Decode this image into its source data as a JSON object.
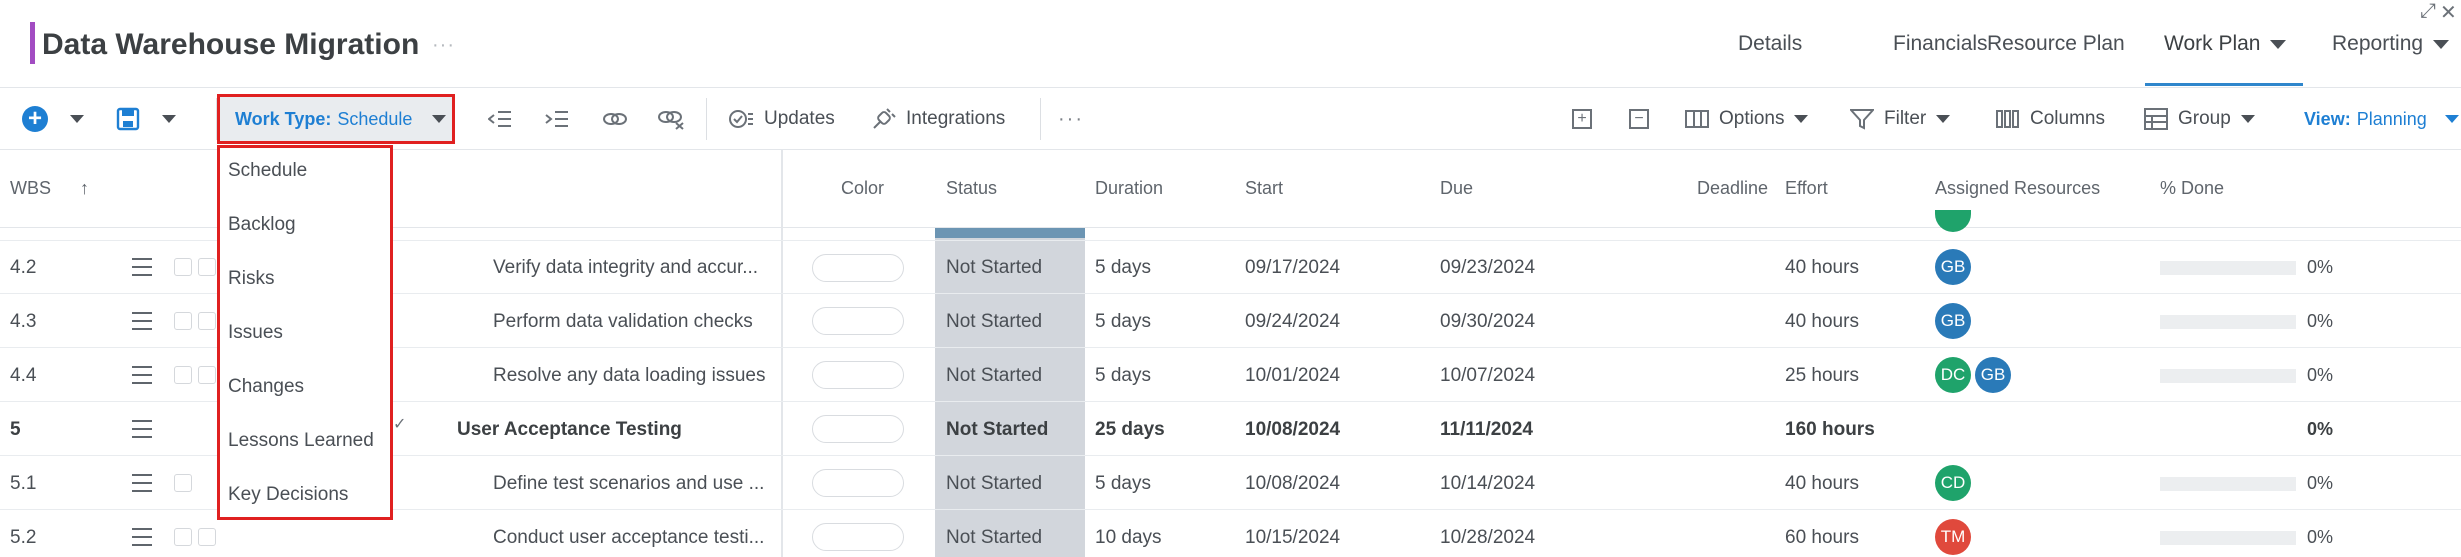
{
  "header": {
    "title": "Data Warehouse Migration",
    "more": "···",
    "window_controls": {
      "expand": "⤢",
      "close": "✕"
    },
    "nav": [
      {
        "label": "Details"
      },
      {
        "label": "Financials"
      },
      {
        "label": "Resource Plan"
      },
      {
        "label": "Work Plan"
      },
      {
        "label": "Reporting"
      }
    ]
  },
  "toolbar": {
    "add": "+",
    "updates": "Updates",
    "integrations": "Integrations",
    "more": "···",
    "work_type_label": "Work Type:",
    "work_type_value": "Schedule",
    "options": "Options",
    "filter": "Filter",
    "columns": "Columns",
    "group": "Group",
    "view_label": "View:",
    "view_value": "Planning"
  },
  "work_type_menu": {
    "items": [
      "Schedule",
      "Backlog",
      "Risks",
      "Issues",
      "Changes",
      "Lessons Learned",
      "Key Decisions"
    ]
  },
  "grid": {
    "columns": {
      "wbs": "WBS",
      "color": "Color",
      "status": "Status",
      "duration": "Duration",
      "start": "Start",
      "due": "Due",
      "deadline": "Deadline",
      "effort": "Effort",
      "assigned": "Assigned Resources",
      "done": "% Done"
    },
    "rows": [
      {
        "wbs": "4.2",
        "name": "Verify data integrity and accur...",
        "status": "Not Started",
        "duration": "5 days",
        "start": "09/17/2024",
        "due": "09/23/2024",
        "effort": "40 hours",
        "avatars": [
          "GB"
        ],
        "done": "0%"
      },
      {
        "wbs": "4.3",
        "name": "Perform data validation checks",
        "status": "Not Started",
        "duration": "5 days",
        "start": "09/24/2024",
        "due": "09/30/2024",
        "effort": "40 hours",
        "avatars": [
          "GB"
        ],
        "done": "0%"
      },
      {
        "wbs": "4.4",
        "name": "Resolve any data loading issues",
        "status": "Not Started",
        "duration": "5 days",
        "start": "10/01/2024",
        "due": "10/07/2024",
        "effort": "25 hours",
        "avatars": [
          "DC",
          "GB"
        ],
        "done": "0%"
      },
      {
        "wbs": "5",
        "name": "User Acceptance Testing",
        "status": "Not Started",
        "duration": "25 days",
        "start": "10/08/2024",
        "due": "11/11/2024",
        "effort": "160 hours",
        "avatars": [],
        "done": "0%"
      },
      {
        "wbs": "5.1",
        "name": "Define test scenarios and use ...",
        "status": "Not Started",
        "duration": "5 days",
        "start": "10/08/2024",
        "due": "10/14/2024",
        "effort": "40 hours",
        "avatars": [
          "CD"
        ],
        "done": "0%"
      },
      {
        "wbs": "5.2",
        "name": "Conduct user acceptance testi...",
        "status": "Not Started",
        "duration": "10 days",
        "start": "10/15/2024",
        "due": "10/28/2024",
        "effort": "60 hours",
        "avatars": [
          "TM"
        ],
        "done": "0%"
      }
    ]
  },
  "colors": {
    "accent": "#a24cc2",
    "primary": "#1e7fd3",
    "highlight_border": "#e02020",
    "avatar_blue": "#2a7ab8",
    "avatar_green": "#1fa36b",
    "avatar_red": "#e0493c",
    "status_bg": "#d2d6dc"
  }
}
